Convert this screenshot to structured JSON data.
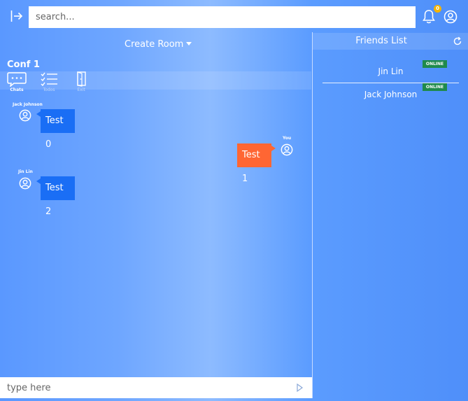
{
  "topbar": {
    "search_placeholder": "search...",
    "notification_count": "0",
    "icons": [
      "sidebar-toggle-icon",
      "bell-icon",
      "user-circle-icon"
    ]
  },
  "room": {
    "create_label": "Create Room",
    "title": "Conf 1",
    "toolbar": [
      {
        "label": "Chats",
        "icon": "chat-bubble-icon",
        "active": true
      },
      {
        "label": "Todos",
        "icon": "checklist-icon",
        "active": false
      },
      {
        "label": "Exit",
        "icon": "door-icon",
        "active": false
      }
    ]
  },
  "messages": [
    {
      "sender": "Jack Johnson",
      "text": "Test 0",
      "side": "left"
    },
    {
      "sender": "You",
      "text": "Test 1",
      "side": "right"
    },
    {
      "sender": "Jin Lin",
      "text": "Test 2",
      "side": "left"
    }
  ],
  "friends": {
    "title": "Friends List",
    "items": [
      {
        "name": "Jin Lin",
        "status": "ONLINE"
      },
      {
        "name": "Jack Johnson",
        "status": "ONLINE"
      }
    ]
  },
  "composer": {
    "placeholder": "type here"
  },
  "colors": {
    "incoming_bubble": "#1a6ef5",
    "outgoing_bubble": "#ff6633",
    "online_badge": "#1f8a4c",
    "notification_badge": "#f5b400"
  }
}
